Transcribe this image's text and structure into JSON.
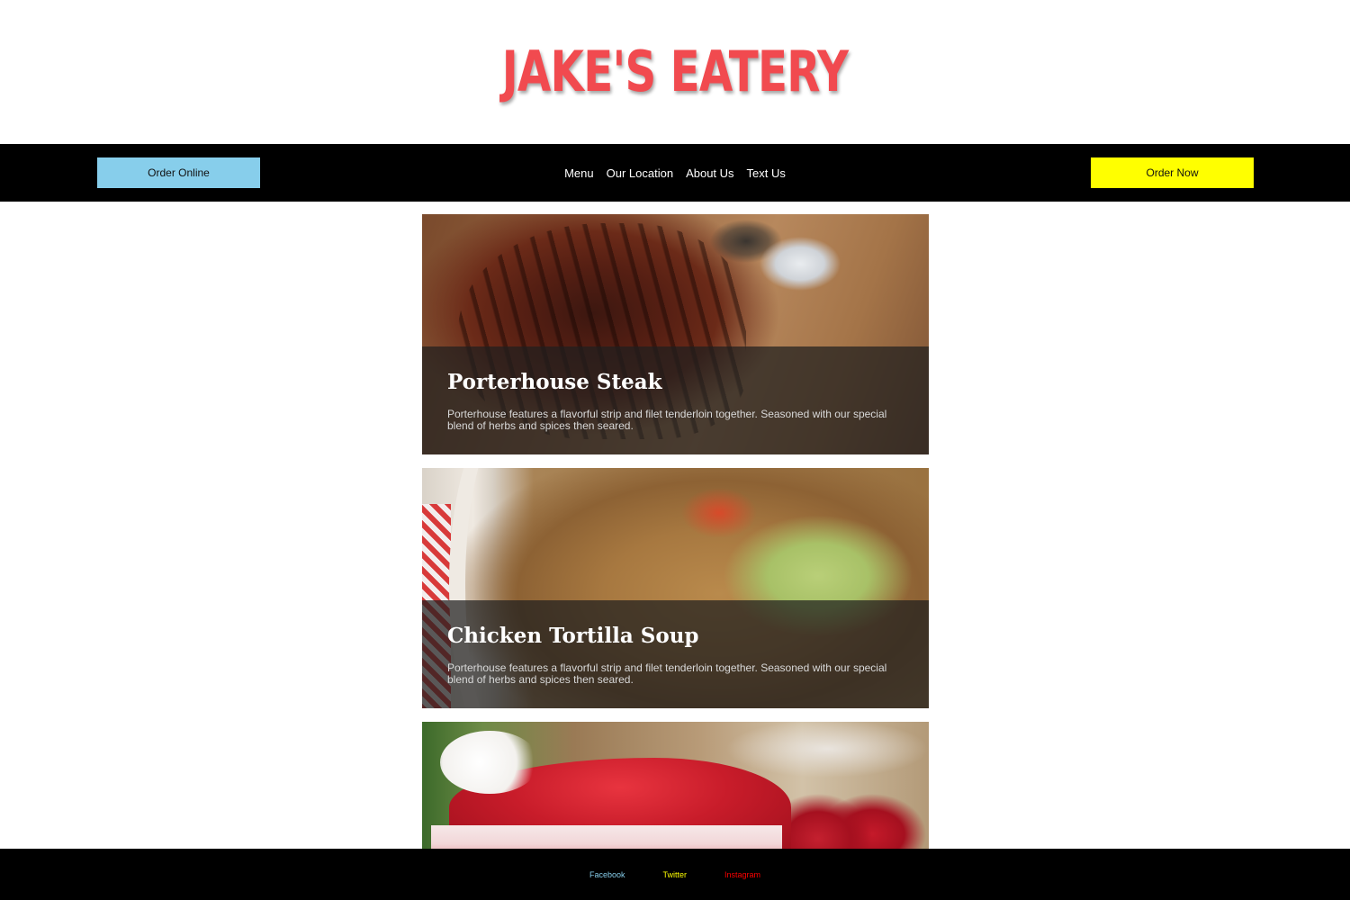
{
  "header": {
    "logo_text": "JAKE'S EATERY"
  },
  "nav": {
    "order_online_label": "Order Online",
    "order_now_label": "Order Now",
    "links": [
      {
        "label": "Menu"
      },
      {
        "label": "Our Location"
      },
      {
        "label": "About Us"
      },
      {
        "label": "Text Us"
      }
    ]
  },
  "menu": {
    "items": [
      {
        "title": "Porterhouse Steak",
        "description": "Porterhouse features a flavorful strip and filet tenderloin together. Seasoned with our special blend of herbs and spices then seared."
      },
      {
        "title": "Chicken Tortilla Soup",
        "description": "Porterhouse features a flavorful strip and filet tenderloin together. Seasoned with our special blend of herbs and spices then seared."
      },
      {
        "title": "",
        "description": ""
      }
    ]
  },
  "footer": {
    "links": [
      {
        "label": "Facebook"
      },
      {
        "label": "Twitter"
      },
      {
        "label": "Instagram"
      }
    ]
  },
  "colors": {
    "logo": "#f14a4f",
    "order_online_bg": "#87ceeb",
    "order_now_bg": "#ffff00",
    "nav_bg": "#000000",
    "facebook": "#87ceeb",
    "twitter": "#ffff00",
    "instagram": "#ff0000"
  }
}
